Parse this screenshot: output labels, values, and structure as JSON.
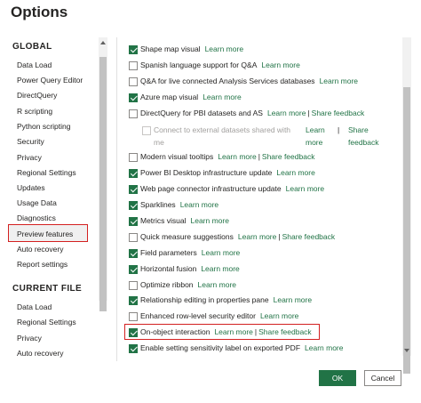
{
  "window": {
    "title": "Options"
  },
  "nav": {
    "global_heading": "GLOBAL",
    "global_items": [
      "Data Load",
      "Power Query Editor",
      "DirectQuery",
      "R scripting",
      "Python scripting",
      "Security",
      "Privacy",
      "Regional Settings",
      "Updates",
      "Usage Data",
      "Diagnostics",
      "Preview features",
      "Auto recovery",
      "Report settings"
    ],
    "selected_item": "Preview features",
    "current_file_heading": "CURRENT FILE",
    "current_file_items": [
      "Data Load",
      "Regional Settings",
      "Privacy",
      "Auto recovery"
    ]
  },
  "features": [
    {
      "label": "Shape map visual",
      "checked": true,
      "learn_more": "Learn more"
    },
    {
      "label": "Spanish language support for Q&A",
      "checked": false,
      "learn_more": "Learn more"
    },
    {
      "label": "Q&A for live connected Analysis Services databases",
      "checked": false,
      "learn_more": "Learn more"
    },
    {
      "label": "Azure map visual",
      "checked": true,
      "learn_more": "Learn more"
    },
    {
      "label": "DirectQuery for PBI datasets and AS",
      "checked": false,
      "learn_more": "Learn more",
      "share_feedback": "Share feedback"
    },
    {
      "label": "Connect to external datasets shared with me",
      "checked": false,
      "disabled": true,
      "learn_more": "Learn more",
      "share_feedback": "Share feedback"
    },
    {
      "label": "Modern visual tooltips",
      "checked": false,
      "learn_more": "Learn more",
      "share_feedback": "Share feedback"
    },
    {
      "label": "Power BI Desktop infrastructure update",
      "checked": true,
      "learn_more": "Learn more"
    },
    {
      "label": "Web page connector infrastructure update",
      "checked": true,
      "learn_more": "Learn more"
    },
    {
      "label": "Sparklines",
      "checked": true,
      "learn_more": "Learn more"
    },
    {
      "label": "Metrics visual",
      "checked": true,
      "learn_more": "Learn more"
    },
    {
      "label": "Quick measure suggestions",
      "checked": false,
      "learn_more": "Learn more",
      "share_feedback": "Share feedback"
    },
    {
      "label": "Field parameters",
      "checked": true,
      "learn_more": "Learn more"
    },
    {
      "label": "Horizontal fusion",
      "checked": true,
      "learn_more": "Learn more"
    },
    {
      "label": "Optimize ribbon",
      "checked": false,
      "learn_more": "Learn more"
    },
    {
      "label": "Relationship editing in properties pane",
      "checked": true,
      "learn_more": "Learn more"
    },
    {
      "label": "Enhanced row-level security editor",
      "checked": false,
      "learn_more": "Learn more"
    },
    {
      "label": "On-object interaction",
      "checked": true,
      "highlighted": true,
      "learn_more": "Learn more",
      "share_feedback": "Share feedback"
    },
    {
      "label": "Enable setting sensitivity label on exported PDF",
      "checked": true,
      "learn_more": "Learn more"
    }
  ],
  "buttons": {
    "ok": "OK",
    "cancel": "Cancel"
  },
  "colors": {
    "accent": "#217346",
    "highlight": "#d32020",
    "text": "#252423",
    "disabled": "#a19f9d"
  }
}
